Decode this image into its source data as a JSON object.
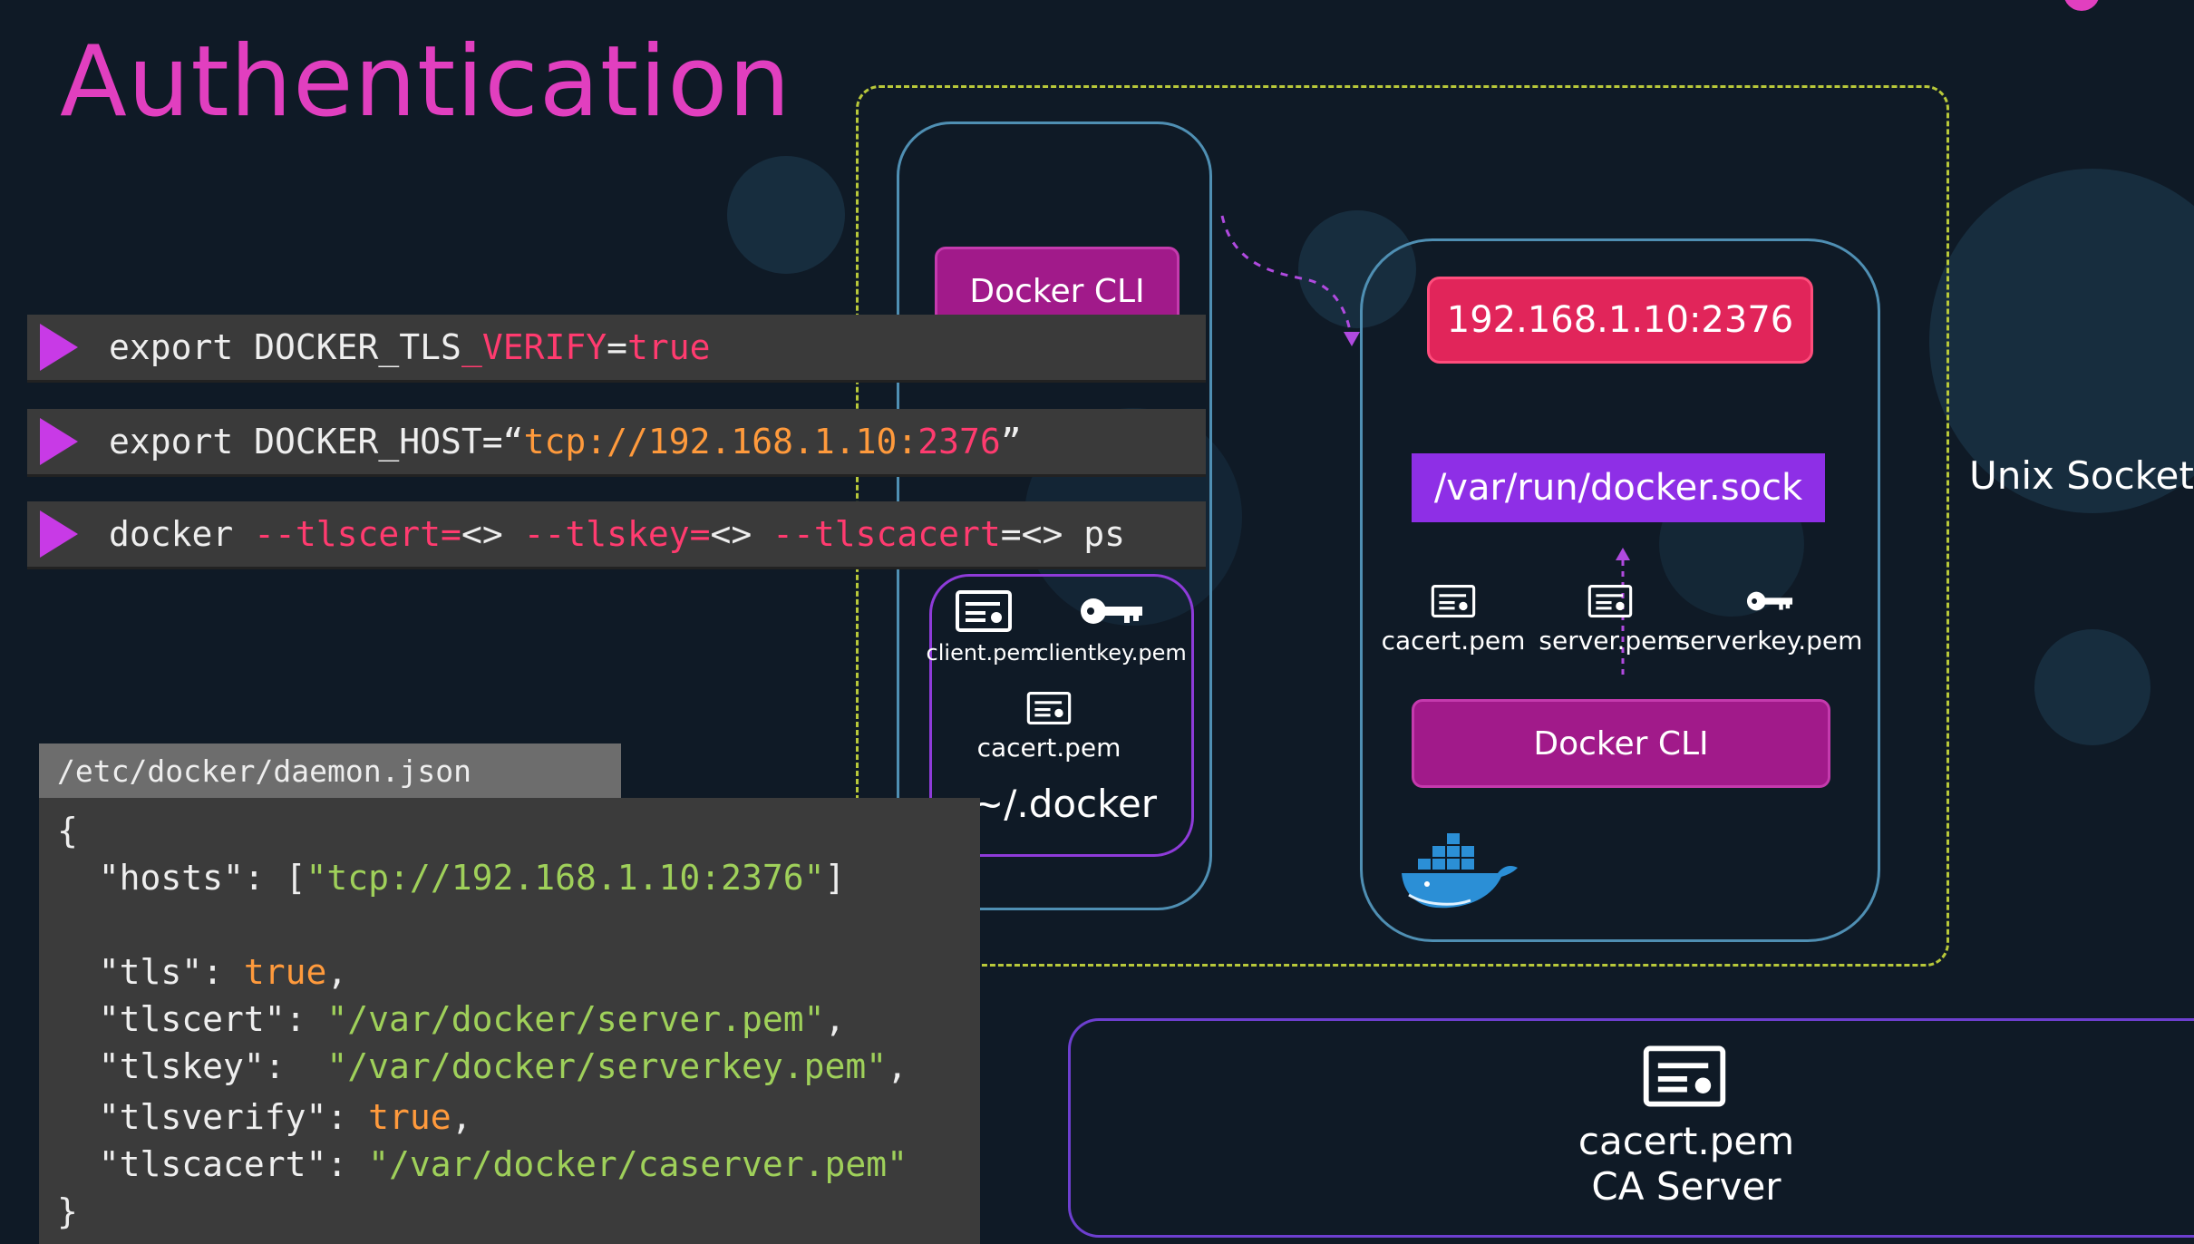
{
  "slide": {
    "title": "Authentication",
    "unix_socket_label": "Unix Socket",
    "home_dir_label": "~/.docker"
  },
  "commands": [
    {
      "parts": [
        [
          "export DOCKER_TLS",
          "w"
        ],
        [
          "_VERIFY",
          "r"
        ],
        [
          "=",
          "w"
        ],
        [
          "true",
          "r"
        ]
      ]
    },
    {
      "parts": [
        [
          "export DOCKER_HOST=“",
          "w"
        ],
        [
          "tcp://192.168.1.10:",
          "o"
        ],
        [
          "2376",
          "r"
        ],
        [
          "”",
          "w"
        ]
      ]
    },
    {
      "parts": [
        [
          "docker ",
          "w"
        ],
        [
          "--tlscert=",
          "r"
        ],
        [
          "<> ",
          "w"
        ],
        [
          "--tlskey=",
          "r"
        ],
        [
          "<> ",
          "w"
        ],
        [
          "--tlscacert",
          "r"
        ],
        [
          "=<> ps",
          "w"
        ]
      ]
    }
  ],
  "client": {
    "docker_cli_label": "Docker CLI",
    "files": {
      "client_pem": "client.pem",
      "clientkey_pem": "clientkey.pem",
      "cacert_pem": "cacert.pem"
    }
  },
  "server": {
    "address": "192.168.1.10:2376",
    "socket_path": "/var/run/docker.sock",
    "docker_cli_label": "Docker CLI",
    "files": {
      "cacert_pem": "cacert.pem",
      "server_pem": "server.pem",
      "serverkey_pem": "serverkey.pem"
    }
  },
  "ca_server": {
    "file": "cacert.pem",
    "label": "CA Server"
  },
  "daemon_json": {
    "path": "/etc/docker/daemon.json",
    "lines": [
      [
        [
          "{",
          "k"
        ]
      ],
      [
        [
          "  \"hosts\": [",
          "k"
        ],
        [
          "\"tcp://192.168.1.10:2376\"",
          "s"
        ],
        [
          "]",
          "k"
        ]
      ],
      [],
      [
        [
          "  \"tls\": ",
          "k"
        ],
        [
          "true",
          "v"
        ],
        [
          ",",
          "k"
        ]
      ],
      [
        [
          "  \"tlscert\": ",
          "k"
        ],
        [
          "\"/var/docker/server.pem\"",
          "s"
        ],
        [
          ",",
          "k"
        ]
      ],
      [
        [
          "  \"tlskey\":  ",
          "k"
        ],
        [
          "\"/var/docker/serverkey.pem\"",
          "s"
        ],
        [
          ",",
          "k"
        ]
      ],
      [
        [
          "  \"tlsverify\": ",
          "k"
        ],
        [
          "true",
          "v"
        ],
        [
          ",",
          "k"
        ]
      ],
      [
        [
          "  \"tlscacert\": ",
          "k"
        ],
        [
          "\"/var/docker/caserver.pem\"",
          "s"
        ]
      ],
      [
        [
          "}",
          "k"
        ]
      ]
    ]
  },
  "colors": {
    "background": "#0f1a26",
    "title": "#e13fbf",
    "docker_cli": "#a11a8a",
    "address_pill": "#e1255a",
    "socket": "#8e2fe6",
    "command_bar": "#3a3a3a",
    "accent_triangle": "#c83ae6"
  }
}
